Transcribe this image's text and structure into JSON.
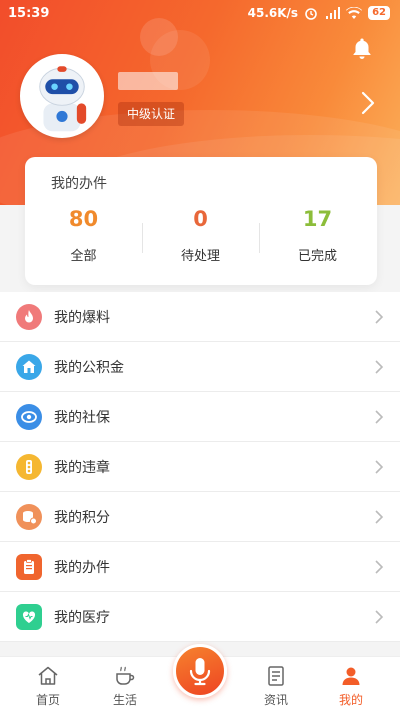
{
  "status_bar": {
    "time": "15:39",
    "network_speed": "45.6K/s",
    "battery": "62"
  },
  "profile": {
    "cert_badge": "中级认证"
  },
  "my_cases": {
    "title": "我的办件",
    "stats": [
      {
        "value": "80",
        "label": "全部",
        "color": "#f08a2c"
      },
      {
        "value": "0",
        "label": "待处理",
        "color": "#e8673a"
      },
      {
        "value": "17",
        "label": "已完成",
        "color": "#8cbd3a"
      }
    ]
  },
  "menu": {
    "items": [
      {
        "label": "我的爆料",
        "icon": "fire-icon",
        "color": "#f07a7a"
      },
      {
        "label": "我的公积金",
        "icon": "house-icon",
        "color": "#3aa7e8"
      },
      {
        "label": "我的社保",
        "icon": "social-security-icon",
        "color": "#3b8ee6"
      },
      {
        "label": "我的违章",
        "icon": "traffic-light-icon",
        "color": "#f5b731"
      },
      {
        "label": "我的积分",
        "icon": "coins-icon",
        "color": "#f0915a"
      },
      {
        "label": "我的办件",
        "icon": "clipboard-icon",
        "color": "#f0652e"
      },
      {
        "label": "我的医疗",
        "icon": "medical-heart-icon",
        "color": "#2fcf90"
      }
    ]
  },
  "bottom_nav": {
    "items": [
      {
        "label": "首页",
        "icon": "home-icon"
      },
      {
        "label": "生活",
        "icon": "coffee-icon"
      },
      {
        "label": "资讯",
        "icon": "news-icon"
      },
      {
        "label": "我的",
        "icon": "person-icon",
        "active": true
      }
    ],
    "center_icon": "microphone-icon"
  }
}
